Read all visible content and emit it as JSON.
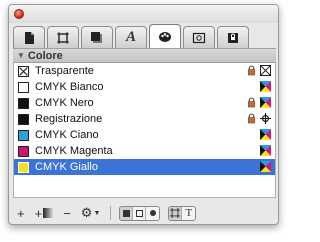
{
  "panel": {
    "section_label": "Colore"
  },
  "tabs": [
    {
      "icon": "page-icon"
    },
    {
      "icon": "frame-icon"
    },
    {
      "icon": "shadow-box-icon"
    },
    {
      "icon": "italic-a-icon",
      "glyph": "A"
    },
    {
      "icon": "palette-icon"
    },
    {
      "icon": "image-frame-icon"
    },
    {
      "icon": "lock-picture-icon"
    }
  ],
  "colors": [
    {
      "name": "Trasparente",
      "swatch": "none",
      "locked": true,
      "type": "none"
    },
    {
      "name": "CMYK Bianco",
      "swatch": "#ffffff",
      "locked": false,
      "type": "cmyk"
    },
    {
      "name": "CMYK Nero",
      "swatch": "#111111",
      "locked": true,
      "type": "cmyk"
    },
    {
      "name": "Registrazione",
      "swatch": "#111111",
      "locked": true,
      "type": "registration"
    },
    {
      "name": "CMYK Ciano",
      "swatch": "#2f9fd6",
      "locked": false,
      "type": "cmyk"
    },
    {
      "name": "CMYK Magenta",
      "swatch": "#c8166e",
      "locked": false,
      "type": "cmyk"
    },
    {
      "name": "CMYK Giallo",
      "swatch": "#f5e41c",
      "locked": false,
      "type": "cmyk",
      "selected": true
    }
  ],
  "bottom": {
    "add_label": "+",
    "add_gradient_label": "+",
    "remove_label": "−",
    "text_mode_label": "T"
  },
  "accent": "#3b73d6"
}
